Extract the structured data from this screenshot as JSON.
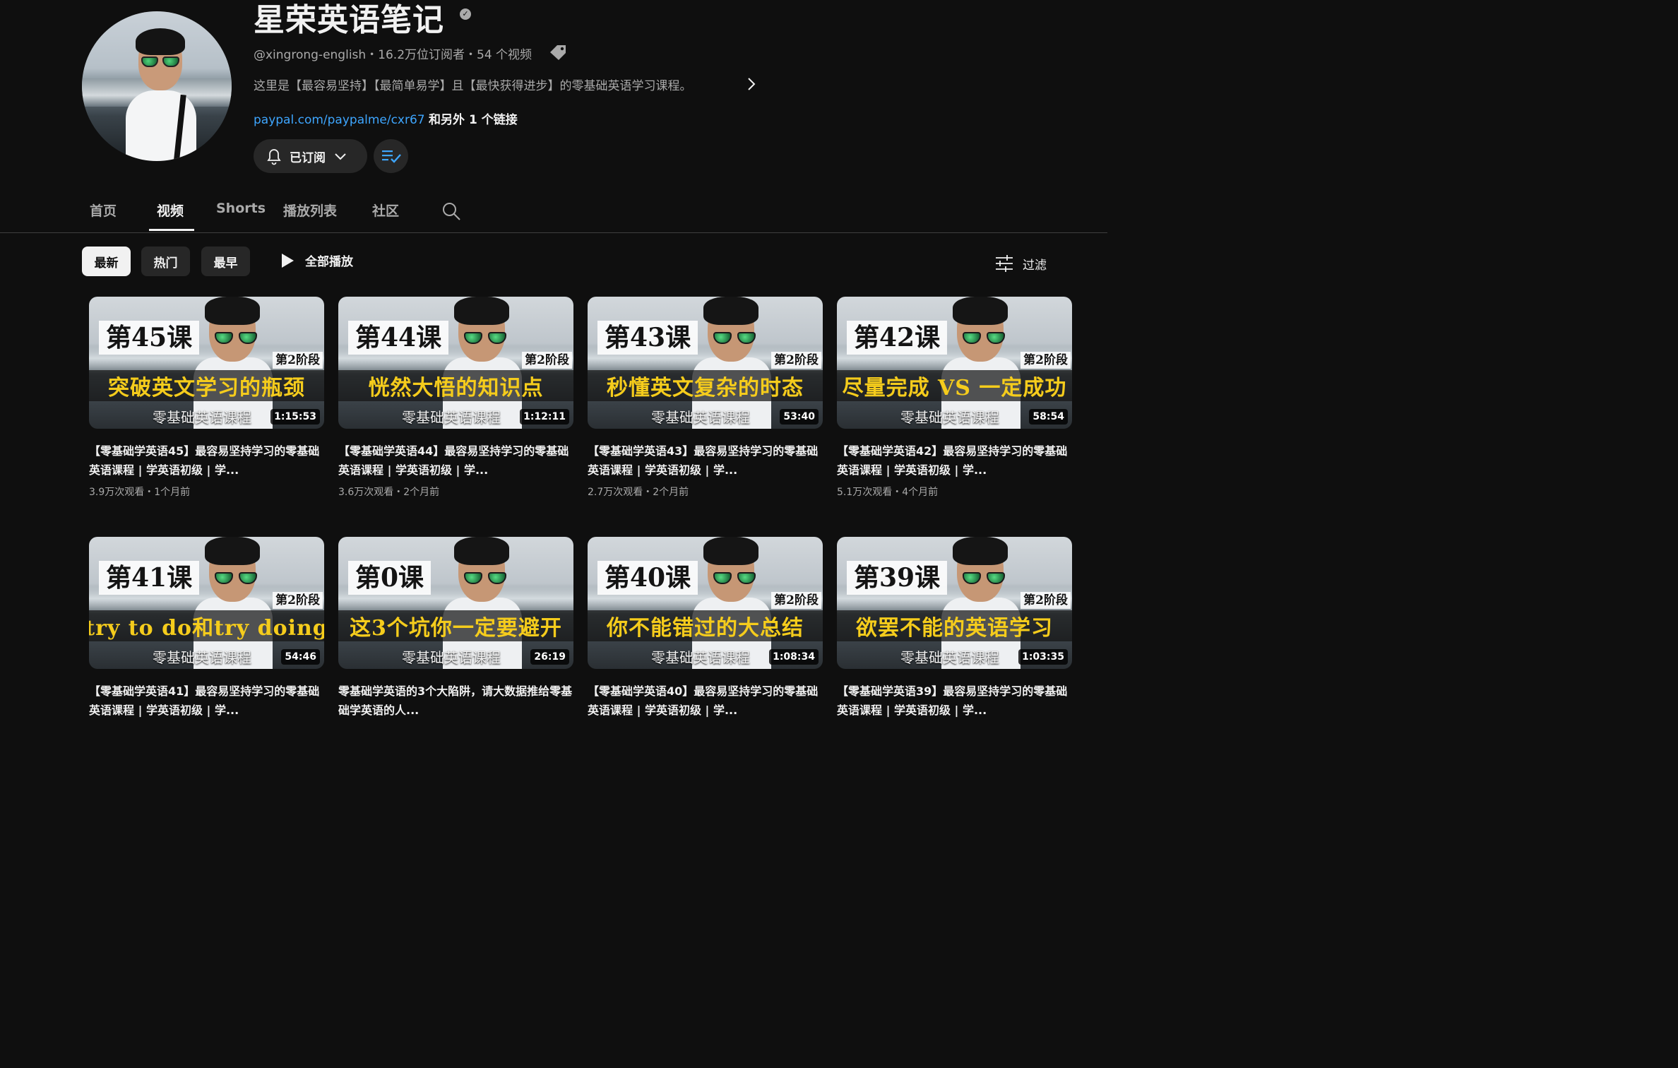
{
  "channel": {
    "title": "星荣英语笔记",
    "meta": "@xingrong-english・16.2万位订阅者・54 个视频",
    "description": "这里是【最容易坚持】【最简单易学】且【最快获得进步】的零基础英语学习课程。",
    "link": "paypal.com/paypalme/cxr67",
    "link_more": "和另外 1 个链接",
    "subscribe_label": "已订阅"
  },
  "tabs": [
    "首页",
    "视频",
    "Shorts",
    "播放列表",
    "社区"
  ],
  "active_tab": "视频",
  "chips": [
    "最新",
    "热门",
    "最早"
  ],
  "active_chip": "最新",
  "play_all_label": "全部播放",
  "filter_label": "过滤",
  "thumb_common": {
    "stage": "第2阶段",
    "course": "零基础英语课程"
  },
  "videos": [
    {
      "lesson": "第45课",
      "headline": "突破英文学习的瓶颈",
      "duration": "1:15:53",
      "title": "【零基础学英语45】最容易坚持学习的零基础英语课程 | 学英语初级 | 学...",
      "meta": "3.9万次观看・1个月前"
    },
    {
      "lesson": "第44课",
      "headline": "恍然大悟的知识点",
      "duration": "1:12:11",
      "title": "【零基础学英语44】最容易坚持学习的零基础英语课程 | 学英语初级 | 学...",
      "meta": "3.6万次观看・2个月前"
    },
    {
      "lesson": "第43课",
      "headline": "秒懂英文复杂的时态",
      "duration": "53:40",
      "title": "【零基础学英语43】最容易坚持学习的零基础英语课程 | 学英语初级 | 学...",
      "meta": "2.7万次观看・2个月前"
    },
    {
      "lesson": "第42课",
      "headline": "尽量完成 VS 一定成功",
      "duration": "58:54",
      "title": "【零基础学英语42】最容易坚持学习的零基础英语课程 | 学英语初级 | 学...",
      "meta": "5.1万次观看・4个月前"
    },
    {
      "lesson": "第41课",
      "headline": "try to do和try doing",
      "duration": "54:46",
      "title": "【零基础学英语41】最容易坚持学习的零基础英语课程 | 学英语初级 | 学...",
      "meta": ""
    },
    {
      "lesson": "第0课",
      "headline": "这3个坑你一定要避开",
      "duration": "26:19",
      "title": "零基础学英语的3个大陷阱，请大数据推给零基础学英语的人...",
      "meta": ""
    },
    {
      "lesson": "第40课",
      "headline": "你不能错过的大总结",
      "duration": "1:08:34",
      "title": "【零基础学英语40】最容易坚持学习的零基础英语课程 | 学英语初级 | 学...",
      "meta": ""
    },
    {
      "lesson": "第39课",
      "headline": "欲罢不能的英语学习",
      "duration": "1:03:35",
      "title": "【零基础学英语39】最容易坚持学习的零基础英语课程 | 学英语初级 | 学...",
      "meta": ""
    }
  ]
}
